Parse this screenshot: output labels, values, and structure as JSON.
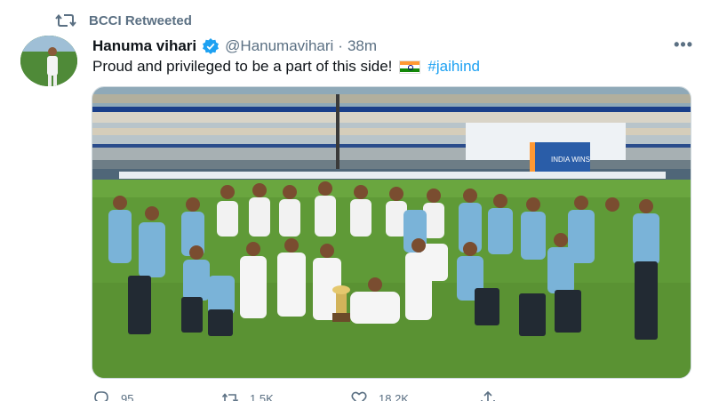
{
  "retweet": {
    "label": "BCCI Retweeted",
    "icon": "retweet-icon"
  },
  "author": {
    "name": "Hanuma vihari",
    "handle": "@Hanumavihari",
    "separator": "·",
    "time": "38m",
    "verified": true
  },
  "tweet": {
    "text": "Proud and privileged to be a part of this side!",
    "flag": "indian-flag-emoji",
    "hashtag": "#jaihind"
  },
  "photo": {
    "board_text": "INDIA WINS"
  },
  "actions": {
    "reply_count": "95",
    "retweet_count": "1.5K",
    "like_count": "18.2K"
  },
  "colors": {
    "accent": "#1da1f2",
    "muted": "#5b7083",
    "pitch": "#5f9a37",
    "kit": "#7ab3d8"
  }
}
